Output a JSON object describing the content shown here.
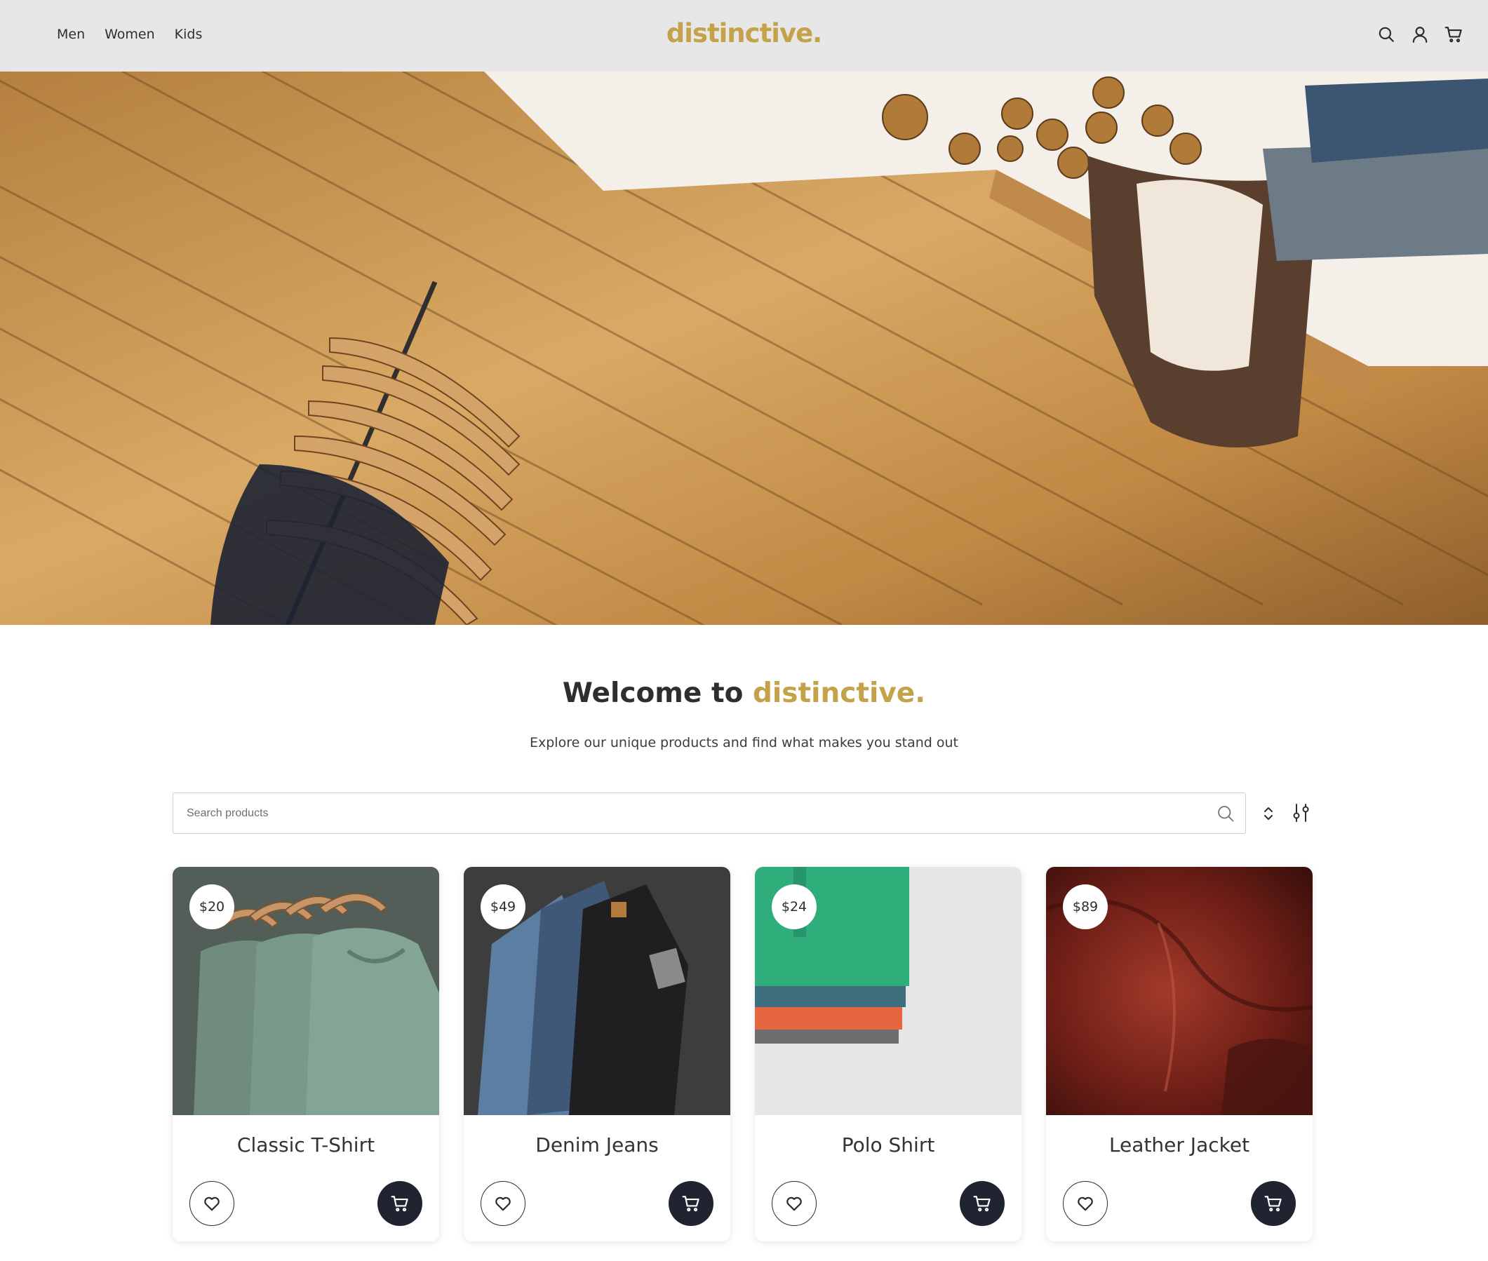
{
  "header": {
    "nav": [
      "Men",
      "Women",
      "Kids"
    ],
    "logo": "distinctive.",
    "icons": [
      "search-icon",
      "user-icon",
      "cart-icon"
    ]
  },
  "hero": {
    "image": "store floor with clothing rack and mannequin"
  },
  "welcome": {
    "title_prefix": "Welcome to",
    "title_accent": "distinctive.",
    "subtitle": "Explore our unique products and find what makes you stand out"
  },
  "search": {
    "placeholder": "Search products",
    "value": ""
  },
  "products": [
    {
      "name": "Classic T-Shirt",
      "price": "$20"
    },
    {
      "name": "Denim Jeans",
      "price": "$49"
    },
    {
      "name": "Polo Shirt",
      "price": "$24"
    },
    {
      "name": "Leather Jacket",
      "price": "$89"
    }
  ],
  "colors": {
    "accent": "#c4a24a",
    "header_bg": "#e7e7e7",
    "cart_button": "#1f2430"
  }
}
